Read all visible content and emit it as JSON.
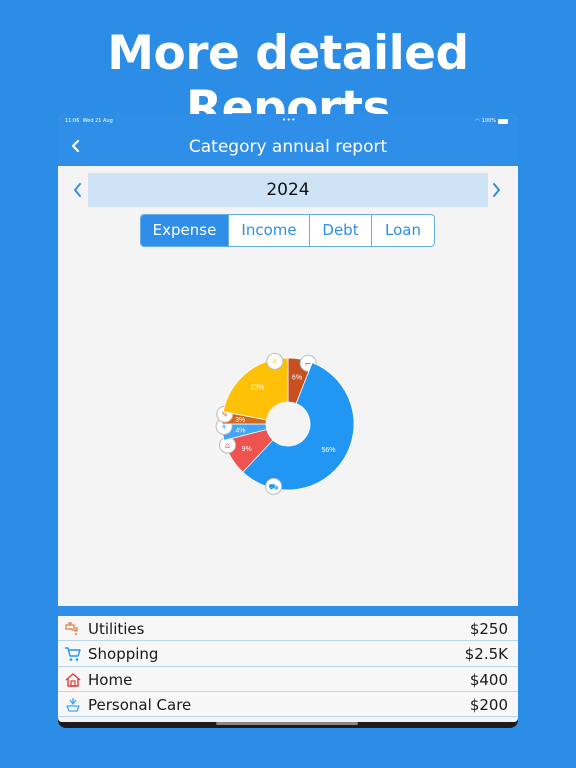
{
  "headline": "More detailed Reports",
  "status_bar": {
    "time": "11:06",
    "date": "Wed 21 Aug",
    "battery": "100%"
  },
  "nav": {
    "title": "Category annual report"
  },
  "year": "2024",
  "tabs": [
    {
      "label": "Expense",
      "active": true
    },
    {
      "label": "Income",
      "active": false
    },
    {
      "label": "Debt",
      "active": false
    },
    {
      "label": "Loan",
      "active": false
    }
  ],
  "chart_data": {
    "type": "pie",
    "slices": [
      {
        "label": "6%",
        "value": 6,
        "color": "#c8501e",
        "icon": "faucet-icon"
      },
      {
        "label": "56%",
        "value": 56,
        "color": "#2196f3",
        "icon": "cart-icon"
      },
      {
        "label": "9%",
        "value": 9,
        "color": "#ef5350",
        "icon": "home-icon"
      },
      {
        "label": "4%",
        "value": 4,
        "color": "#42a5f5",
        "icon": "personal-care-icon"
      },
      {
        "label": "3%",
        "value": 3,
        "color": "#d2691e",
        "icon": "hair-dryer-icon"
      },
      {
        "label": "22%",
        "value": 22,
        "color": "#ffc107",
        "icon": "entertainment-icon"
      }
    ]
  },
  "list": [
    {
      "name": "Utilities",
      "amount": "$250",
      "icon": "faucet-icon",
      "color": "#e07b39"
    },
    {
      "name": "Shopping",
      "amount": "$2.5K",
      "icon": "cart-icon",
      "color": "#2196f3"
    },
    {
      "name": "Home",
      "amount": "$400",
      "icon": "home-icon",
      "color": "#e53935"
    },
    {
      "name": "Personal Care",
      "amount": "$200",
      "icon": "personal-care-icon",
      "color": "#42a5f5"
    }
  ]
}
